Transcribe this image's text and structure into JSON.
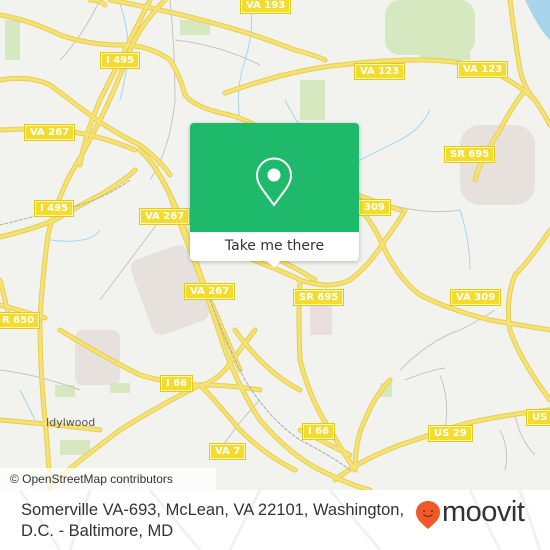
{
  "map": {
    "attribution": "© OpenStreetMap contributors",
    "colors": {
      "background": "#f2f2ef",
      "road": "#f6e173",
      "road_casing": "#e6cf52",
      "shield": "#f3dc2e",
      "park": "#d6e8bf",
      "water": "#a8d4ec",
      "urban": "#e6e1dd"
    },
    "road_labels": [
      {
        "id": "va193",
        "text": "VA 193"
      },
      {
        "id": "i495-top",
        "text": "I 495"
      },
      {
        "id": "va123-a",
        "text": "VA 123"
      },
      {
        "id": "va123-b",
        "text": "VA 123"
      },
      {
        "id": "va267-a",
        "text": "VA 267"
      },
      {
        "id": "sr695-top",
        "text": "SR 695"
      },
      {
        "id": "i495-mid",
        "text": "I 495"
      },
      {
        "id": "va267-b",
        "text": "VA 267"
      },
      {
        "id": "va309-a",
        "text": "309"
      },
      {
        "id": "va267-c",
        "text": "VA 267"
      },
      {
        "id": "sr695-mid",
        "text": "SR 695"
      },
      {
        "id": "va309-b",
        "text": "VA 309"
      },
      {
        "id": "sr650",
        "text": "R 650"
      },
      {
        "id": "i66-a",
        "text": "I 66"
      },
      {
        "id": "i66-b",
        "text": "I 66"
      },
      {
        "id": "us29-a",
        "text": "US 29"
      },
      {
        "id": "us29-b",
        "text": "US"
      },
      {
        "id": "va7",
        "text": "VA 7"
      }
    ],
    "places": [
      {
        "id": "idylwood",
        "text": "Idylwood"
      }
    ]
  },
  "popup": {
    "button_label": "Take me there",
    "accent": "#1fb96b",
    "icon": "map-pin-icon"
  },
  "footer": {
    "address": "Somerville VA-693, McLean, VA 22101, Washington, D.C. - Baltimore, MD",
    "logo_text": "moovit",
    "logo_color": "#f05a28"
  }
}
